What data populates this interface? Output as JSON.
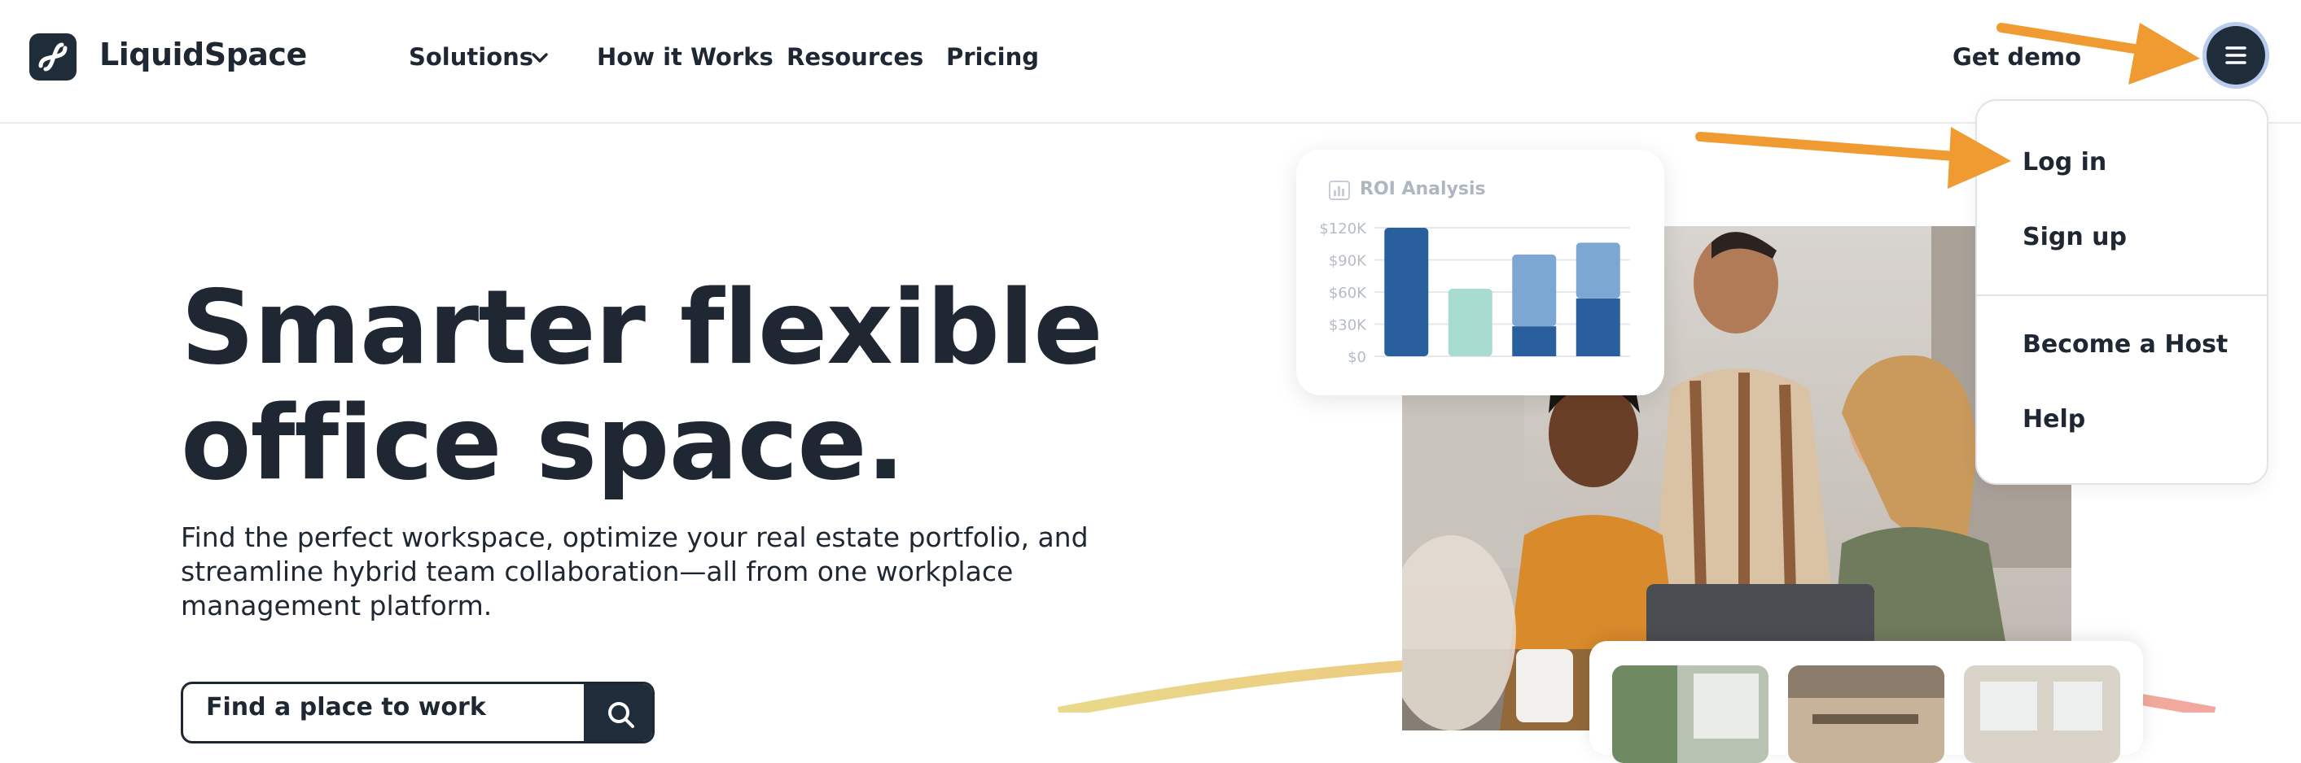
{
  "brand": {
    "name": "LiquidSpace"
  },
  "nav": {
    "items": [
      {
        "label": "Solutions",
        "has_dropdown": true
      },
      {
        "label": "How it Works"
      },
      {
        "label": "Resources"
      },
      {
        "label": "Pricing"
      }
    ],
    "get_demo": "Get demo"
  },
  "user_menu": {
    "items": [
      "Log in",
      "Sign up",
      "Become a Host",
      "Help"
    ]
  },
  "hero": {
    "title_line1": "Smarter flexible",
    "title_line2": "office space.",
    "subtitle": "Find the perfect workspace, optimize your real estate portfolio, and streamline hybrid team collaboration—all from one workplace management platform."
  },
  "search": {
    "value": "Find a place to work"
  },
  "roi_card": {
    "title": "ROI Analysis"
  },
  "chart_data": {
    "type": "bar",
    "title": "ROI Analysis",
    "y_ticks": [
      "$120K",
      "$90K",
      "$60K",
      "$30K",
      "$0"
    ],
    "ylim": [
      0,
      120000
    ],
    "grid": true,
    "bars": [
      {
        "total": 120000,
        "segments": [
          {
            "value": 120000,
            "color": "#2a5f9e"
          }
        ]
      },
      {
        "total": 63000,
        "segments": [
          {
            "value": 63000,
            "color": "#a9dcd0"
          }
        ]
      },
      {
        "total": 95000,
        "segments": [
          {
            "value": 28000,
            "color": "#2a5f9e"
          },
          {
            "value": 67000,
            "color": "#7ba7d2"
          }
        ]
      },
      {
        "total": 106000,
        "segments": [
          {
            "value": 54000,
            "color": "#2a5f9e"
          },
          {
            "value": 52000,
            "color": "#7ba7d2"
          }
        ]
      }
    ]
  },
  "colors": {
    "text": "#1f2733",
    "navy": "#1f2d3a",
    "annotation_arrow": "#f09a32",
    "menu_ring": "#b9ccee"
  },
  "icons": {
    "logo": "liquidspace-logo-icon",
    "chevron": "chevron-down-icon",
    "menu": "hamburger-menu-icon",
    "search": "search-icon",
    "chart": "bar-chart-icon"
  }
}
